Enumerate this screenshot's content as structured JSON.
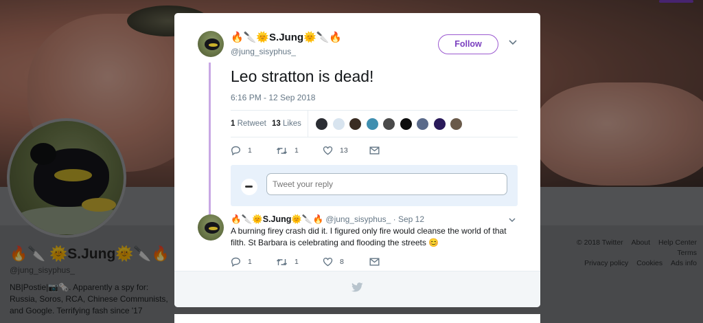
{
  "profile": {
    "display_name": "🔥🔪 🌞S.Jung🌞🔪🔥",
    "handle": "@jung_sisyphus_",
    "bio": "NB|Postie|📷🗞️. Apparently a spy for: Russia, Soros, RCA, Chinese Communists, and Google. Terrifying fash since '17"
  },
  "footer": {
    "copyright": "© 2018 Twitter",
    "about": "About",
    "help": "Help Center",
    "terms": "Terms",
    "privacy": "Privacy policy",
    "cookies": "Cookies",
    "ads": "Ads info"
  },
  "tweet": {
    "author_name": "🔥🔪🌞S.Jung🌞🔪🔥",
    "author_handle": "@jung_sisyphus_",
    "follow_label": "Follow",
    "text": "Leo stratton is dead!",
    "timestamp": "6:16 PM - 12 Sep 2018",
    "retweet_count": "1",
    "retweet_label": "Retweet",
    "like_count": "13",
    "like_label": "Likes",
    "actions": {
      "reply": "1",
      "retweet": "1",
      "like": "13"
    },
    "liker_colors": [
      "#2b2d33",
      "#d8e4ef",
      "#3a2c22",
      "#3f8fb0",
      "#4a4a4a",
      "#0d0d0d",
      "#5a6a8a",
      "#2a1a5a",
      "#6a5a4a"
    ]
  },
  "reply_box": {
    "placeholder": "Tweet your reply"
  },
  "reply": {
    "author_name": "🔥🔪🌞S.Jung🌞🔪🔥",
    "author_handle": "@jung_sisyphus_",
    "date": "· Sep 12",
    "text": "A burning firey crash did it. I figured only fire would cleanse the world of that filth. St Barbara is celebrating and flooding the streets 😊",
    "actions": {
      "reply": "1",
      "retweet": "1",
      "like": "8"
    }
  },
  "colors": {
    "accent": "#7a3fbf",
    "thread_line": "#c8a8e4",
    "text_muted": "#657786"
  }
}
